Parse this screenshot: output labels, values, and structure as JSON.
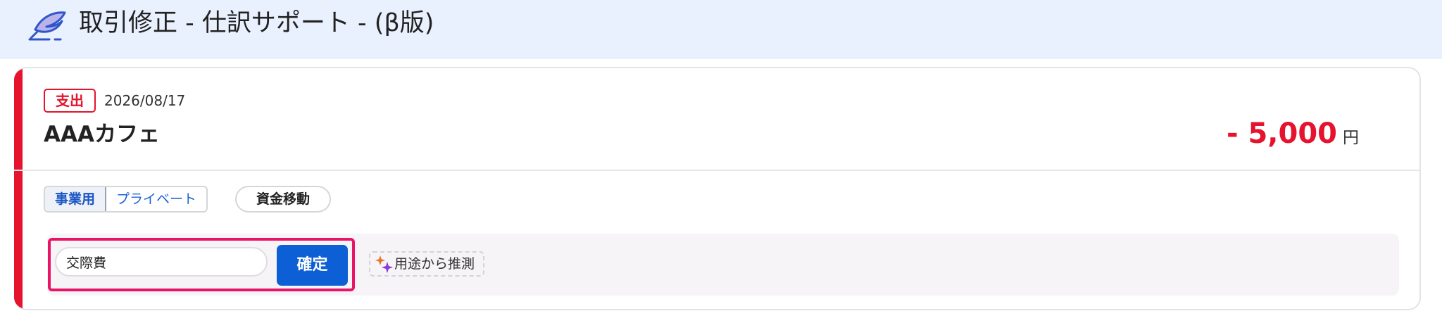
{
  "header": {
    "title": "取引修正 - 仕訳サポート - (β版)",
    "logo_icon": "quill-icon",
    "background": "#e9f1fe"
  },
  "transaction": {
    "type_badge": "支出",
    "date": "2026/08/17",
    "name": "AAAカフェ",
    "amount": "- 5,000",
    "currency_unit": "円",
    "accent_color": "#e5132d"
  },
  "usage_toggle": {
    "options": [
      "事業用",
      "プライベート"
    ],
    "selected": "事業用"
  },
  "transfer_button_label": "資金移動",
  "account": {
    "value": "交際費",
    "confirm_label": "確定",
    "guess_label": "用途から推測",
    "guess_icon": "sparkle-icon",
    "confirm_color": "#0d5fd5",
    "focus_color": "#ea1466"
  }
}
